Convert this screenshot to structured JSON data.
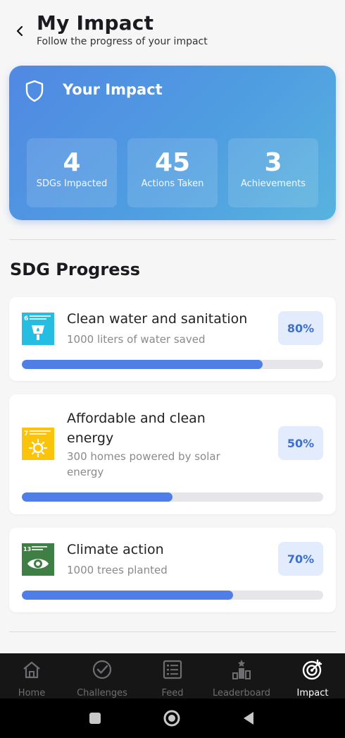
{
  "header": {
    "title": "My Impact",
    "subtitle": "Follow the progress of your impact"
  },
  "impact_card": {
    "title": "Your Impact",
    "stats": [
      {
        "value": "4",
        "label": "SDGs Impacted"
      },
      {
        "value": "45",
        "label": "Actions Taken"
      },
      {
        "value": "3",
        "label": "Achievements"
      }
    ]
  },
  "sdg_section": {
    "title": "SDG Progress",
    "items": [
      {
        "name": "Clean water and sanitation",
        "description": "1000 liters of water saved",
        "percent_label": "80%",
        "progress": 0.8,
        "icon_number": "6",
        "icon_color": "#26bde2",
        "icon": "water-tap-icon"
      },
      {
        "name_line1": "Affordable and clean",
        "name_line2": "energy",
        "desc_line1": "300 homes powered by solar",
        "desc_line2": "energy",
        "percent_label": "50%",
        "progress": 0.5,
        "icon_number": "7",
        "icon_color": "#fcc30b",
        "icon": "sun-energy-icon"
      },
      {
        "name": "Climate action",
        "description": "1000 trees planted",
        "percent_label": "70%",
        "progress": 0.7,
        "icon_number": "13",
        "icon_color": "#3f7e44",
        "icon": "earth-eye-icon"
      }
    ]
  },
  "bottom_nav": {
    "items": [
      {
        "label": "Home",
        "icon": "home-icon"
      },
      {
        "label": "Challenges",
        "icon": "check-circle-icon"
      },
      {
        "label": "Feed",
        "icon": "list-icon"
      },
      {
        "label": "Leaderboard",
        "icon": "podium-icon"
      },
      {
        "label": "Impact",
        "icon": "target-icon"
      }
    ],
    "active_index": 4
  },
  "colors": {
    "accent": "#4e7ee6",
    "card_gradient_start": "#5188e3",
    "card_gradient_end": "#58b3de",
    "badge_bg": "#e3ecfc"
  }
}
